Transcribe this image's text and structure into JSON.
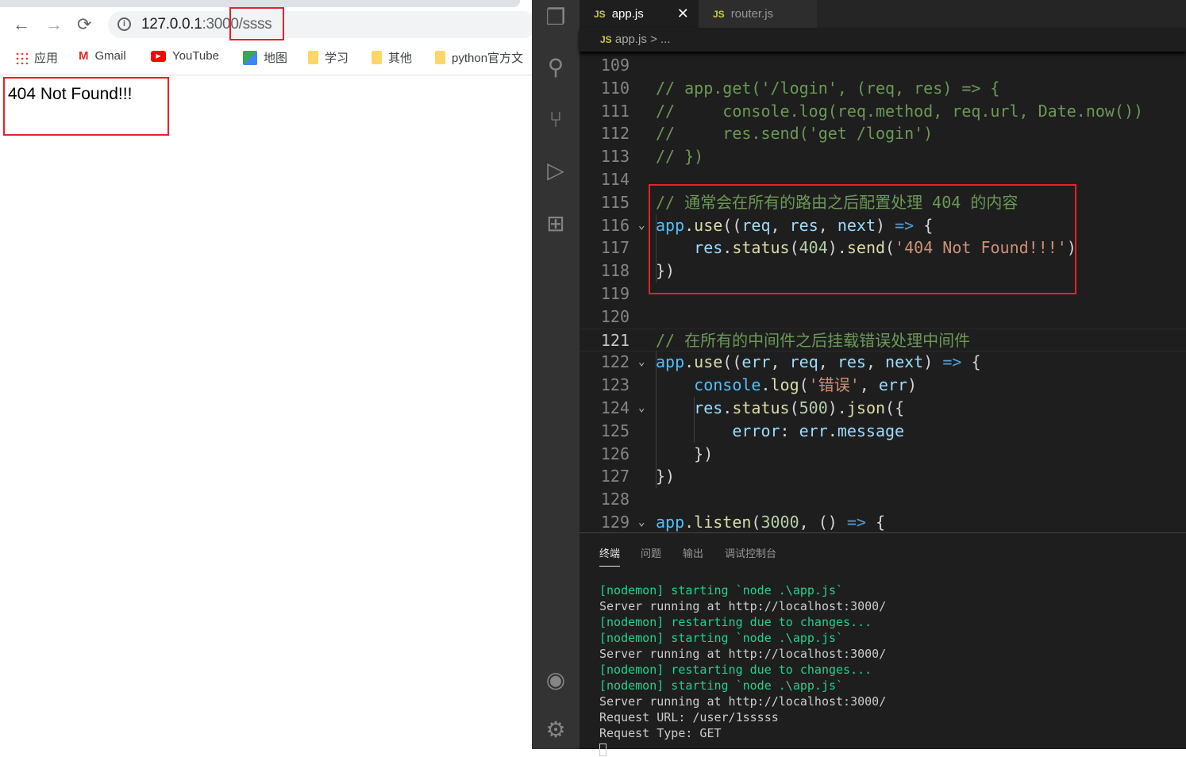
{
  "browser": {
    "url_host": "127.0.0.1",
    "url_rest": ":3000/ssss",
    "bookmarks": [
      {
        "label": "应用",
        "icon": "apps-grid-icon"
      },
      {
        "label": "Gmail",
        "icon": "gmail-icon"
      },
      {
        "label": "YouTube",
        "icon": "youtube-icon"
      },
      {
        "label": "地图",
        "icon": "maps-icon"
      },
      {
        "label": "学习",
        "icon": "folder-icon"
      },
      {
        "label": "其他",
        "icon": "folder-icon"
      },
      {
        "label": "python官方文",
        "icon": "folder-icon"
      }
    ],
    "page_text": "404 Not Found!!!"
  },
  "editor": {
    "tabs": [
      {
        "label": "app.js",
        "active": true,
        "badge": "JS"
      },
      {
        "label": "router.js",
        "active": false,
        "badge": "JS"
      }
    ],
    "breadcrumb": {
      "file": "app.js",
      "sep": ">",
      "rest": "..."
    },
    "current_line": 121,
    "lines": [
      {
        "n": "109",
        "t": []
      },
      {
        "n": "110",
        "t": [
          [
            "// app.get('/login', (req, res) => {",
            "c"
          ]
        ]
      },
      {
        "n": "111",
        "t": [
          [
            "//     console.log(req.method, req.url, Date.now())",
            "c"
          ]
        ]
      },
      {
        "n": "112",
        "t": [
          [
            "//     res.send('get /login')",
            "c"
          ]
        ]
      },
      {
        "n": "113",
        "t": [
          [
            "// })",
            "c"
          ]
        ]
      },
      {
        "n": "114",
        "t": []
      },
      {
        "n": "115",
        "t": [
          [
            "// 通常会在所有的路由之后配置处理 404 的内容",
            "c"
          ]
        ]
      },
      {
        "n": "116",
        "fold": true,
        "t": [
          [
            "app",
            "o"
          ],
          [
            ".",
            "p"
          ],
          [
            "use",
            "f"
          ],
          [
            "((",
            "p"
          ],
          [
            "req",
            "v"
          ],
          [
            ", ",
            "p"
          ],
          [
            "res",
            "v"
          ],
          [
            ", ",
            "p"
          ],
          [
            "next",
            "v"
          ],
          [
            ") ",
            "p"
          ],
          [
            "=>",
            "k"
          ],
          [
            " {",
            "p"
          ]
        ]
      },
      {
        "n": "117",
        "t": [
          [
            "    res",
            "v"
          ],
          [
            ".",
            "p"
          ],
          [
            "status",
            "f"
          ],
          [
            "(",
            "p"
          ],
          [
            "404",
            "n"
          ],
          [
            ").",
            "p"
          ],
          [
            "send",
            "f"
          ],
          [
            "(",
            "p"
          ],
          [
            "'404 Not Found!!!'",
            "s"
          ],
          [
            ")",
            "p"
          ]
        ]
      },
      {
        "n": "118",
        "t": [
          [
            "})",
            "p"
          ]
        ]
      },
      {
        "n": "119",
        "t": []
      },
      {
        "n": "120",
        "t": []
      },
      {
        "n": "121",
        "t": [
          [
            "// 在所有的中间件之后挂载错误处理中间件",
            "c"
          ]
        ]
      },
      {
        "n": "122",
        "fold": true,
        "t": [
          [
            "app",
            "o"
          ],
          [
            ".",
            "p"
          ],
          [
            "use",
            "f"
          ],
          [
            "((",
            "p"
          ],
          [
            "err",
            "v"
          ],
          [
            ", ",
            "p"
          ],
          [
            "req",
            "v"
          ],
          [
            ", ",
            "p"
          ],
          [
            "res",
            "v"
          ],
          [
            ", ",
            "p"
          ],
          [
            "next",
            "v"
          ],
          [
            ") ",
            "p"
          ],
          [
            "=>",
            "k"
          ],
          [
            " {",
            "p"
          ]
        ]
      },
      {
        "n": "123",
        "t": [
          [
            "    console",
            "o"
          ],
          [
            ".",
            "p"
          ],
          [
            "log",
            "f"
          ],
          [
            "(",
            "p"
          ],
          [
            "'错误'",
            "s"
          ],
          [
            ", ",
            "p"
          ],
          [
            "err",
            "v"
          ],
          [
            ")",
            "p"
          ]
        ]
      },
      {
        "n": "124",
        "fold": true,
        "t": [
          [
            "    res",
            "v"
          ],
          [
            ".",
            "p"
          ],
          [
            "status",
            "f"
          ],
          [
            "(",
            "p"
          ],
          [
            "500",
            "n"
          ],
          [
            ").",
            "p"
          ],
          [
            "json",
            "f"
          ],
          [
            "({",
            "p"
          ]
        ]
      },
      {
        "n": "125",
        "t": [
          [
            "        error",
            "v"
          ],
          [
            ": ",
            "p"
          ],
          [
            "err",
            "v"
          ],
          [
            ".",
            "p"
          ],
          [
            "message",
            "v"
          ]
        ]
      },
      {
        "n": "126",
        "t": [
          [
            "    })",
            "p"
          ]
        ]
      },
      {
        "n": "127",
        "t": [
          [
            "})",
            "p"
          ]
        ]
      },
      {
        "n": "128",
        "t": []
      },
      {
        "n": "129",
        "fold": true,
        "t": [
          [
            "app",
            "o"
          ],
          [
            ".",
            "p"
          ],
          [
            "listen",
            "f"
          ],
          [
            "(",
            "p"
          ],
          [
            "3000",
            "n"
          ],
          [
            ", () ",
            "p"
          ],
          [
            "=>",
            "k"
          ],
          [
            " {",
            "p"
          ]
        ]
      }
    ]
  },
  "panel": {
    "tabs": [
      "终端",
      "问题",
      "输出",
      "调试控制台"
    ],
    "terminal": [
      {
        "text": "[nodemon] starting `node .\\app.js`",
        "g": true
      },
      {
        "text": "Server running at http://localhost:3000/",
        "g": false
      },
      {
        "text": "[nodemon] restarting due to changes...",
        "g": true
      },
      {
        "text": "[nodemon] starting `node .\\app.js`",
        "g": true
      },
      {
        "text": "Server running at http://localhost:3000/",
        "g": false
      },
      {
        "text": "[nodemon] restarting due to changes...",
        "g": true
      },
      {
        "text": "[nodemon] starting `node .\\app.js`",
        "g": true
      },
      {
        "text": "Server running at http://localhost:3000/",
        "g": false
      },
      {
        "text": "Request URL: /user/1sssss",
        "g": false
      },
      {
        "text": "Request Type: GET",
        "g": false
      }
    ]
  },
  "colors": {
    "highlight": "#e8202a",
    "terminal_green": "#23d18b"
  }
}
